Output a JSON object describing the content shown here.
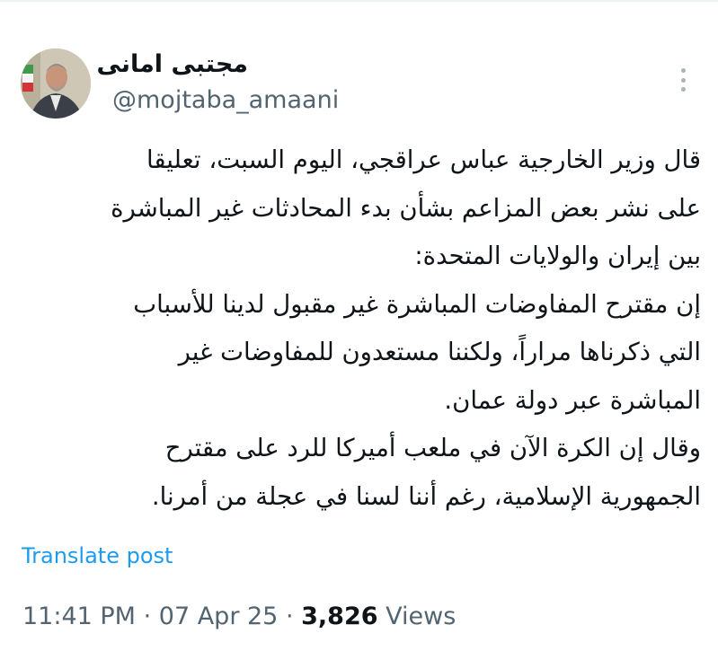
{
  "author": {
    "display_name": "مجتبی امانی",
    "handle": "@mojtaba_amaani",
    "avatar_icon": "profile-photo-avatar"
  },
  "more_icon": "more-horizontal-icon",
  "tweet": {
    "lines": [
      "قال وزير الخارجية عباس عراقجي، اليوم السبت، تعليقا",
      "على نشر بعض المزاعم بشأن بدء المحادثات غير المباشرة",
      "بين إيران والولايات المتحدة:",
      "إن مقترح المفاوضات المباشرة غير مقبول لدينا للأسباب",
      "التي ذكرناها مراراً، ولكننا مستعدون للمفاوضات غير",
      "المباشرة عبر دولة عمان.",
      "وقال إن الكرة الآن في ملعب أميركا للرد على مقترح",
      "الجمهورية الإسلامية، رغم أننا لسنا في عجلة من أمرنا."
    ]
  },
  "translate_label": "Translate post",
  "meta": {
    "time": "11:41 PM",
    "separator": "·",
    "date": "07 Apr 25",
    "views_count": "3,826",
    "views_label": "Views"
  },
  "colors": {
    "link": "#1d9bf0",
    "secondary_text": "#536471",
    "primary_text": "#0f1419"
  }
}
